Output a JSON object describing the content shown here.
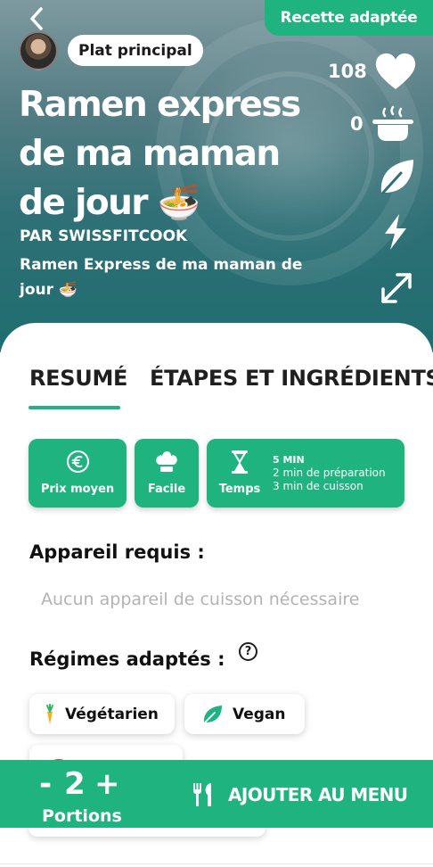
{
  "header": {
    "badge": "Recette adaptée",
    "category": "Plat principal",
    "title": "Ramen express de ma maman de jour 🍜",
    "author": "PAR SWISSFITCOOK",
    "subtitle": "Ramen Express de ma maman de jour 🍜",
    "likes_count": "108",
    "cooked_count": "0",
    "icons": [
      "back-arrow-icon",
      "heart-icon",
      "pot-icon",
      "leaf-icon",
      "lightning-icon",
      "expand-icon"
    ]
  },
  "tabs": [
    {
      "label": "RESUMÉ",
      "active": true
    },
    {
      "label": "ÉTAPES ET INGRÉDIENTS",
      "active": false
    }
  ],
  "info_cards": {
    "price_label": "Prix moyen",
    "difficulty_label": "Facile",
    "time_label": "Temps",
    "time_total": "5 MIN",
    "time_prep": "2 min de préparation",
    "time_cook": "3 min de cuisson"
  },
  "equipment": {
    "title": "Appareil requis :",
    "value": "Aucun appareil de cuisson nécessaire"
  },
  "diets": {
    "title": "Régimes adaptés :",
    "help": "?",
    "items": [
      "Végétarien",
      "Vegan"
    ]
  },
  "bottom_bar": {
    "minus": "-",
    "portions": "2",
    "plus": "+",
    "portions_label": "Portions",
    "add_to_menu": "AJOUTER AU MENU"
  },
  "colors": {
    "accent": "#1fb380",
    "hero_teal": "#2e7076"
  }
}
